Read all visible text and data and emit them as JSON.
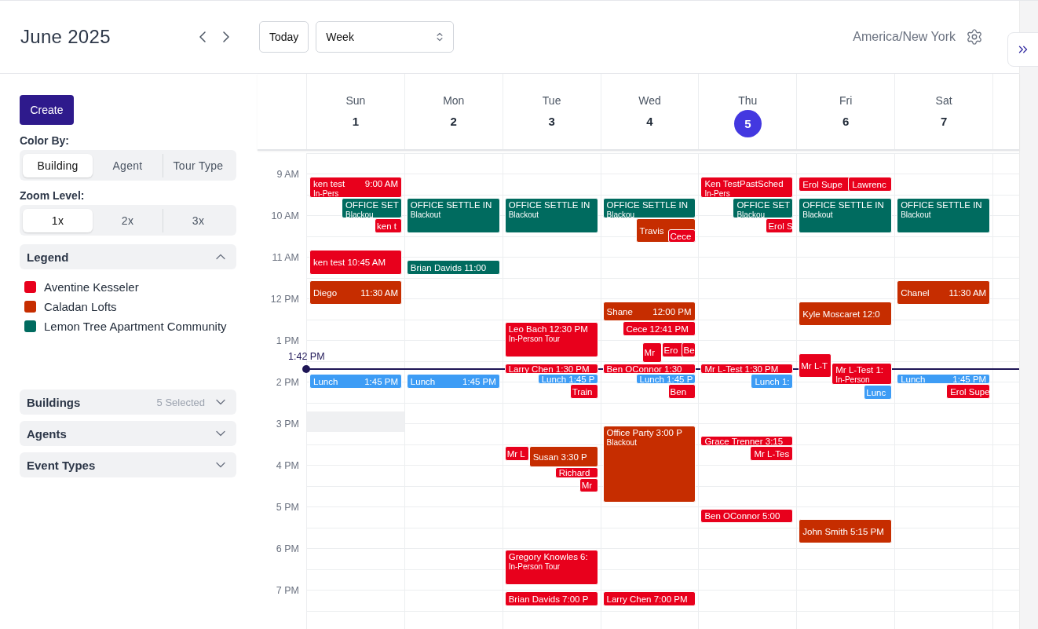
{
  "header": {
    "month": "June 2025",
    "today_button": "Today",
    "view_select": {
      "value": "Week"
    },
    "timezone": "America/New York"
  },
  "sidebar": {
    "create_button": "Create",
    "color_by": {
      "label": "Color By:",
      "options": [
        {
          "label": "Building",
          "selected": true
        },
        {
          "label": "Agent",
          "selected": false
        },
        {
          "label": "Tour Type",
          "selected": false
        }
      ]
    },
    "zoom_level": {
      "label": "Zoom Level:",
      "options": [
        {
          "label": "1x",
          "selected": true
        },
        {
          "label": "2x",
          "selected": false
        },
        {
          "label": "3x",
          "selected": false
        }
      ]
    },
    "legend": {
      "title": "Legend",
      "expanded": true,
      "items": [
        {
          "label": "Aventine Kesseler",
          "color": "#e8001c"
        },
        {
          "label": "Caladan Lofts",
          "color": "#c62d00"
        },
        {
          "label": "Lemon Tree Apartment Community",
          "color": "#006b5f"
        }
      ]
    },
    "filters": [
      {
        "title": "Buildings",
        "summary": "5 Selected",
        "expanded": false
      },
      {
        "title": "Agents",
        "expanded": false
      },
      {
        "title": "Event Types",
        "expanded": false
      }
    ]
  },
  "calendar": {
    "hours": [
      "9 AM",
      "10 AM",
      "11 AM",
      "12 PM",
      "1 PM",
      "2 PM",
      "3 PM",
      "4 PM",
      "5 PM",
      "6 PM",
      "7 PM"
    ],
    "now_label": "1:42 PM",
    "days": [
      {
        "name": "Sun",
        "date": "1",
        "selected": false,
        "events": [
          {
            "kind": "event",
            "title": "ken test",
            "time": "9:00 AM",
            "subtitle": "In-Pers",
            "color": "#e8001c"
          },
          {
            "kind": "event",
            "title": "OFFICE SET",
            "subtitle": "Blackou",
            "color": "#006b5f"
          },
          {
            "kind": "event",
            "title": "ken t",
            "color": "#e8001c"
          },
          {
            "kind": "event",
            "title": "ken test 10:45 AM",
            "color": "#e8001c"
          },
          {
            "kind": "event",
            "title": "Diego",
            "time": "11:30 AM",
            "color": "#c62d00"
          },
          {
            "kind": "event",
            "title": "Lunch",
            "time": "1:45 PM",
            "color": "#3d9cf5"
          },
          {
            "kind": "blocked"
          }
        ]
      },
      {
        "name": "Mon",
        "date": "2",
        "selected": false,
        "events": [
          {
            "kind": "event",
            "title": "OFFICE SETTLE IN",
            "subtitle": "Blackout",
            "color": "#006b5f"
          },
          {
            "kind": "event",
            "title": "Brian Davids 11:00",
            "color": "#006b5f"
          },
          {
            "kind": "event",
            "title": "Lunch",
            "time": "1:45 PM",
            "color": "#3d9cf5"
          }
        ]
      },
      {
        "name": "Tue",
        "date": "3",
        "selected": false,
        "events": [
          {
            "kind": "event",
            "title": "OFFICE SETTLE IN",
            "subtitle": "Blackout",
            "color": "#006b5f"
          },
          {
            "kind": "event",
            "title": "Leo Bach 12:30 PM",
            "subtitle": "In-Person Tour",
            "color": "#e8001c"
          },
          {
            "kind": "event",
            "title": "Larry Chen 1:30 PM",
            "color": "#e8001c"
          },
          {
            "kind": "event",
            "title": "Lunch 1:45 P",
            "color": "#3d9cf5"
          },
          {
            "kind": "event",
            "title": "Train",
            "color": "#e8001c"
          },
          {
            "kind": "event",
            "title": "Mr L",
            "color": "#e8001c"
          },
          {
            "kind": "event",
            "title": "Susan 3:30 P",
            "color": "#c62d00"
          },
          {
            "kind": "event",
            "title": "Richard",
            "color": "#e8001c"
          },
          {
            "kind": "event",
            "title": "Mr",
            "color": "#e8001c"
          },
          {
            "kind": "event",
            "title": "Gregory Knowles 6:",
            "subtitle": "In-Person Tour",
            "color": "#e8001c"
          },
          {
            "kind": "event",
            "title": "Brian Davids 7:00 P",
            "color": "#e8001c"
          }
        ]
      },
      {
        "name": "Wed",
        "date": "4",
        "selected": false,
        "events": [
          {
            "kind": "event",
            "title": "OFFICE SETTLE IN",
            "subtitle": "Blackou",
            "color": "#006b5f"
          },
          {
            "kind": "event",
            "title": "Travis",
            "color": "#c62d00"
          },
          {
            "kind": "event",
            "title": "Cece",
            "color": "#e8001c"
          },
          {
            "kind": "event",
            "title": "Shane",
            "time": "12:00 PM",
            "color": "#c62d00"
          },
          {
            "kind": "event",
            "title": "Cece 12:41 PM",
            "color": "#e8001c"
          },
          {
            "kind": "event",
            "title": "Mr",
            "color": "#e8001c"
          },
          {
            "kind": "event",
            "title": "Ero",
            "color": "#e8001c"
          },
          {
            "kind": "event",
            "title": "Be",
            "color": "#e8001c"
          },
          {
            "kind": "event",
            "title": "Ben OConnor 1:30",
            "color": "#e8001c"
          },
          {
            "kind": "event",
            "title": "Lunch 1:45 P",
            "color": "#3d9cf5"
          },
          {
            "kind": "event",
            "title": "Ben",
            "color": "#e8001c"
          },
          {
            "kind": "event",
            "title": "Office Party 3:00 P",
            "subtitle": "Blackout",
            "color": "#c62d00"
          },
          {
            "kind": "event",
            "title": "Larry Chen 7:00 PM",
            "color": "#e8001c"
          }
        ]
      },
      {
        "name": "Thu",
        "date": "5",
        "selected": true,
        "events": [
          {
            "kind": "event",
            "title": "Ken TestPastSched",
            "subtitle": "In-Pers",
            "color": "#e8001c"
          },
          {
            "kind": "event",
            "title": "OFFICE SET",
            "subtitle": "Blackou",
            "color": "#006b5f"
          },
          {
            "kind": "event",
            "title": "Erol S",
            "color": "#e8001c"
          },
          {
            "kind": "event",
            "title": "Mr L-Test 1:30 PM",
            "color": "#e8001c"
          },
          {
            "kind": "event",
            "title": "Lunch 1:",
            "color": "#3d9cf5"
          },
          {
            "kind": "event",
            "title": "Grace Trenner 3:15",
            "color": "#e8001c"
          },
          {
            "kind": "event",
            "title": "Mr L-Tes",
            "color": "#e8001c"
          },
          {
            "kind": "event",
            "title": "Ben OConnor 5:00",
            "color": "#e8001c"
          }
        ]
      },
      {
        "name": "Fri",
        "date": "6",
        "selected": false,
        "events": [
          {
            "kind": "event",
            "title": "Erol Supe",
            "color": "#e8001c"
          },
          {
            "kind": "event",
            "title": "Lawrenc",
            "color": "#e8001c"
          },
          {
            "kind": "event",
            "title": "OFFICE SETTLE IN",
            "subtitle": "Blackout",
            "color": "#006b5f"
          },
          {
            "kind": "event",
            "title": "Kyle Moscaret 12:0",
            "color": "#c62d00"
          },
          {
            "kind": "event",
            "title": "Mr L-T",
            "color": "#e8001c"
          },
          {
            "kind": "event",
            "title": "Mr L-Test 1:",
            "subtitle": "In-Person",
            "color": "#e8001c"
          },
          {
            "kind": "event",
            "title": "Lunc",
            "color": "#3d9cf5"
          },
          {
            "kind": "event",
            "title": "John Smith 5:15 PM",
            "color": "#c62d00"
          }
        ]
      },
      {
        "name": "Sat",
        "date": "7",
        "selected": false,
        "events": [
          {
            "kind": "event",
            "title": "OFFICE SETTLE IN",
            "subtitle": "Blackout",
            "color": "#006b5f"
          },
          {
            "kind": "event",
            "title": "Chanel",
            "time": "11:30 AM",
            "color": "#c62d00"
          },
          {
            "kind": "event",
            "title": "Lunch",
            "time": "1:45 PM",
            "color": "#3d9cf5"
          },
          {
            "kind": "event",
            "title": "Erol Supe",
            "color": "#e8001c"
          }
        ]
      }
    ]
  }
}
